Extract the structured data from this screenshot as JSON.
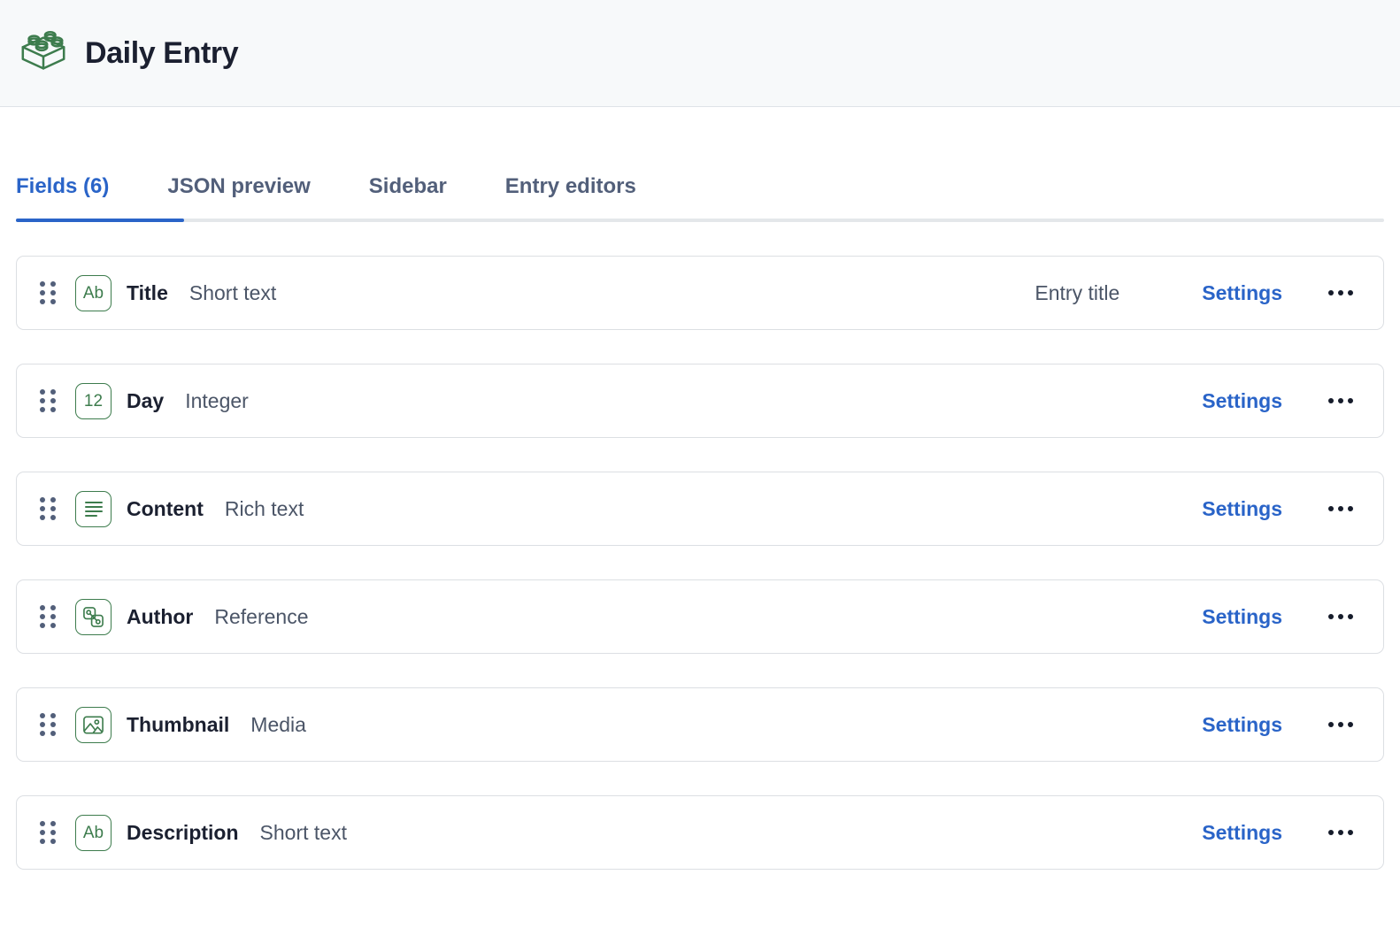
{
  "header": {
    "icon": "brick-icon",
    "title": "Daily Entry"
  },
  "tabs": [
    {
      "label": "Fields (6)",
      "active": true
    },
    {
      "label": "JSON preview",
      "active": false
    },
    {
      "label": "Sidebar",
      "active": false
    },
    {
      "label": "Entry editors",
      "active": false
    }
  ],
  "fields": [
    {
      "icon": "short-text-icon",
      "icon_glyph": "Ab",
      "name": "Title",
      "type": "Short text",
      "badge": "Entry title",
      "settings_label": "Settings",
      "more_label": "•••"
    },
    {
      "icon": "integer-icon",
      "icon_glyph": "12",
      "name": "Day",
      "type": "Integer",
      "badge": "",
      "settings_label": "Settings",
      "more_label": "•••"
    },
    {
      "icon": "rich-text-icon",
      "icon_glyph": "",
      "name": "Content",
      "type": "Rich text",
      "badge": "",
      "settings_label": "Settings",
      "more_label": "•••"
    },
    {
      "icon": "reference-icon",
      "icon_glyph": "",
      "name": "Author",
      "type": "Reference",
      "badge": "",
      "settings_label": "Settings",
      "more_label": "•••"
    },
    {
      "icon": "media-icon",
      "icon_glyph": "",
      "name": "Thumbnail",
      "type": "Media",
      "badge": "",
      "settings_label": "Settings",
      "more_label": "•••"
    },
    {
      "icon": "short-text-icon",
      "icon_glyph": "Ab",
      "name": "Description",
      "type": "Short text",
      "badge": "",
      "settings_label": "Settings",
      "more_label": "•••"
    }
  ],
  "colors": {
    "accent_blue": "#2a64c8",
    "icon_green": "#3d7c4d",
    "text_dark": "#1b2030",
    "text_muted": "#4b5567",
    "header_bg": "#f7f9fa",
    "border": "#dcdfe3"
  }
}
